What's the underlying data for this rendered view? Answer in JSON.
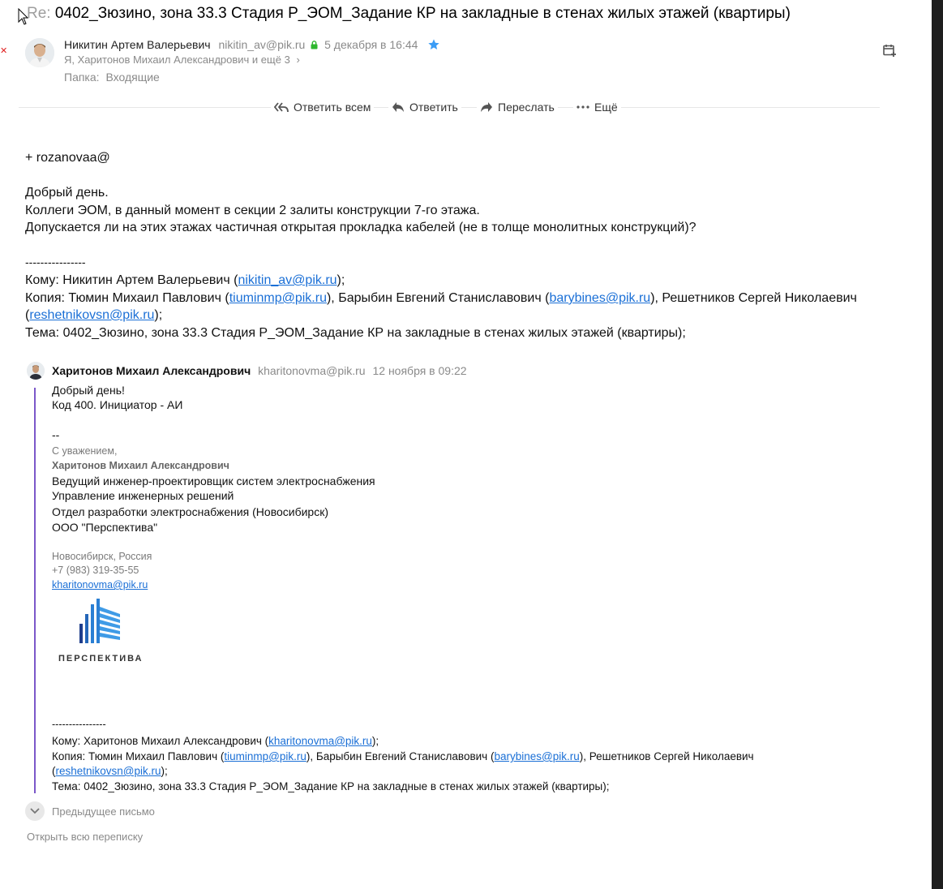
{
  "subject": {
    "prefix": "Re:",
    "text": "0402_Зюзино, зона 33.3 Стадия Р_ЭОМ_Задание КР на закладные в стенах жилых этажей (квартиры)"
  },
  "sender": {
    "name": "Никитин Артем Валерьевич",
    "email": "nikitin_av@pik.ru",
    "date": "5 декабря в 16:44",
    "recipients": "Я, Харитонов Михаил Александрович и ещё 3",
    "folder_label": "Папка:",
    "folder": "Входящие"
  },
  "toolbar": {
    "reply_all": "Ответить всем",
    "reply": "Ответить",
    "forward": "Переслать",
    "more": "Ещё"
  },
  "body": {
    "line1": "+ rozanovaa@",
    "greeting": "Добрый день.",
    "line2": "Коллеги ЭОМ, в данный момент в секции 2 залиты конструкции 7-го этажа.",
    "line3": "Допускается ли на этих этажах частичная открытая прокладка кабелей (не в толще монолитных конструкций)?",
    "separator": "----------------",
    "to_prefix": "Кому: Никитин Артем Валерьевич (",
    "to_email": "nikitin_av@pik.ru",
    "to_suffix": ");",
    "cc_prefix": "Копия: Тюмин Михаил Павлович (",
    "cc_email1": "tiuminmp@pik.ru",
    "cc_mid1": "), Барыбин Евгений Станиславович (",
    "cc_email2": "barybines@pik.ru",
    "cc_mid2": "), Решетников Сергей Николаевич",
    "cc_open": "(",
    "cc_email3": "reshetnikovsn@pik.ru",
    "cc_end": ");",
    "topic": "Тема: 0402_Зюзино, зона 33.3 Стадия Р_ЭОМ_Задание КР на закладные в стенах жилых этажей (квартиры);"
  },
  "quoted": {
    "author": "Харитонов Михаил Александрович",
    "email": "kharitonovma@pik.ru",
    "date": "12 ноября в 09:22",
    "greeting": "Добрый день!",
    "code": "Код 400. Инициатор - АИ",
    "dashes": "--",
    "regards": "С уважением,",
    "sig_name": "Харитонов Михаил Александрович",
    "position": "Ведущий инженер-проектировщик систем электроснабжения",
    "department1": "Управление инженерных решений",
    "department2": "Отдел разработки электроснабжения (Новосибирск)",
    "company": "ООО \"Перспектива\"",
    "city": "Новосибирск, Россия",
    "phone": "+7 (983) 319-35-55",
    "sig_email": "kharitonovma@pik.ru",
    "logo_text": "ПЕРСПЕКТИВА",
    "separator": "----------------",
    "to_prefix": "Кому: Харитонов Михаил Александрович (",
    "to_email": "kharitonovma@pik.ru",
    "to_suffix": ");",
    "cc_prefix": "Копия: Тюмин Михаил Павлович (",
    "cc_email1": "tiuminmp@pik.ru",
    "cc_mid1": "), Барыбин Евгений Станиславович (",
    "cc_email2": "barybines@pik.ru",
    "cc_mid2": "), Решетников Сергей Николаевич",
    "cc_open": "(",
    "cc_email3": "reshetnikovsn@pik.ru",
    "cc_end": ");",
    "topic": "Тема: 0402_Зюзино, зона 33.3 Стадия Р_ЭОМ_Задание КР на закладные в стенах жилых этажей (квартиры);"
  },
  "footer": {
    "previous": "Предыдущее письмо",
    "open_all": "Открыть всю переписку"
  },
  "colors": {
    "link": "#1a6fd6",
    "quote_bar": "#7b57c9",
    "star": "#3b9cf5",
    "lock": "#2eb82e"
  }
}
